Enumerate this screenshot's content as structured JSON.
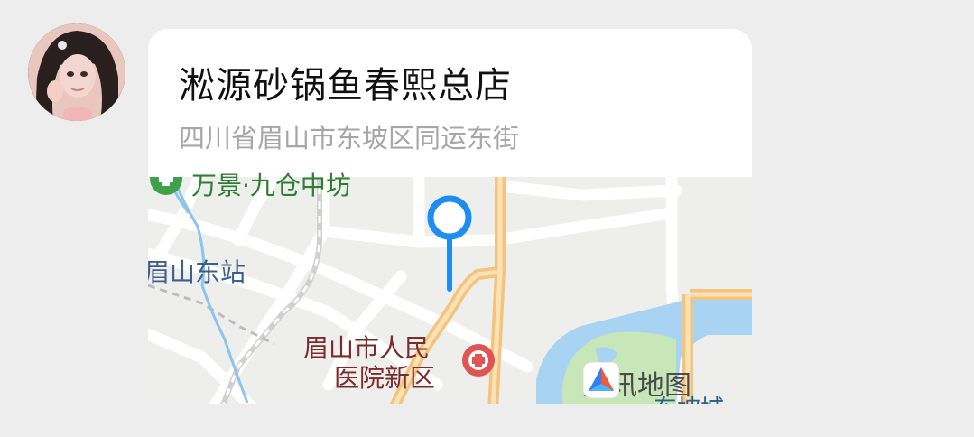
{
  "message": {
    "sender_avatar": "avatar",
    "location_card": {
      "name": "淞源砂锅鱼春熙总店",
      "address": "四川省眉山市东坡区同运东街"
    }
  },
  "map": {
    "labels": {
      "top_partial": "万景·九仓中坊",
      "station": "眉山东站",
      "hospital_line1": "眉山市人民",
      "hospital_line2": "医院新区",
      "bottom_partial": "东坡城"
    },
    "watermark": "腾讯地图",
    "colors": {
      "pin": "#1e8df1",
      "road_major": "#f4c47d",
      "water": "#a9d3f3",
      "park": "#c7e7b9",
      "hospital": "#e05454"
    },
    "icons": [
      "map-pin-icon",
      "hospital-icon",
      "park-icon",
      "tencent-map-logo-icon"
    ]
  }
}
